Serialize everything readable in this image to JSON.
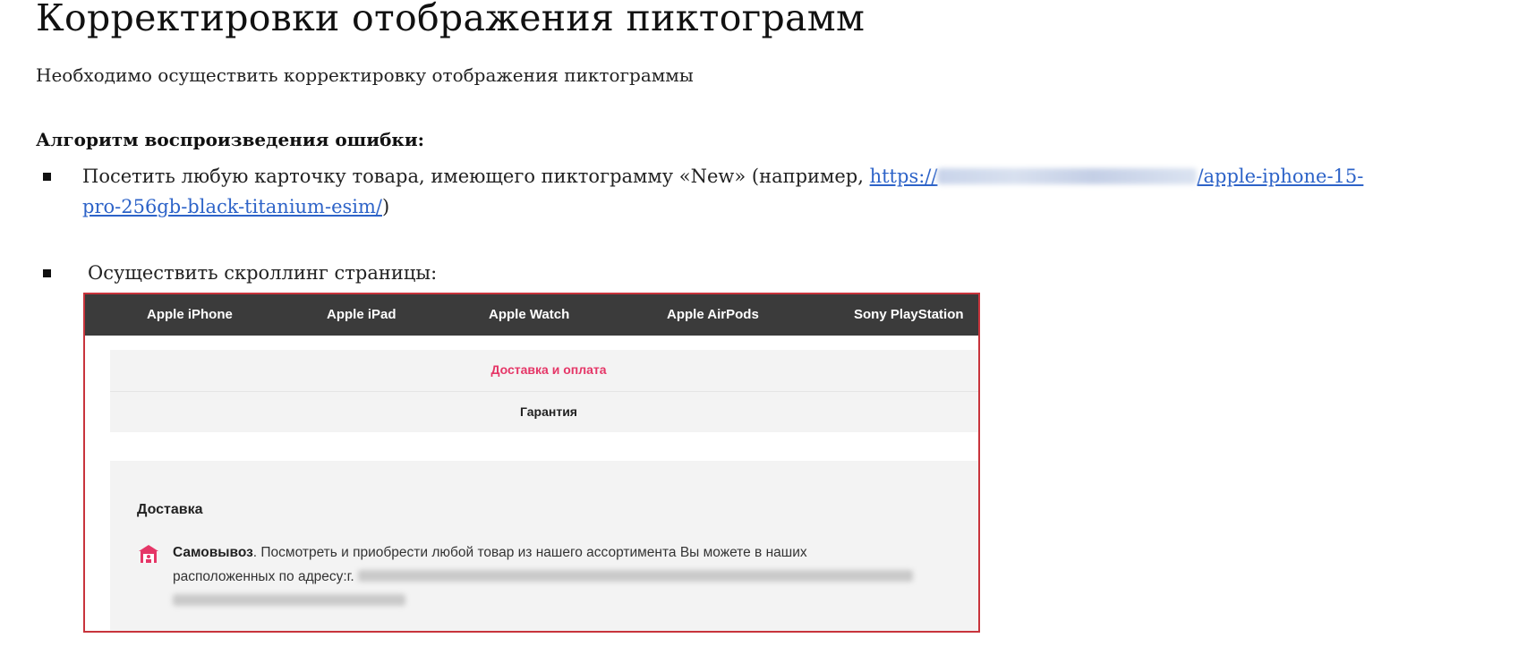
{
  "document": {
    "title": "Корректировки отображения пиктограмм",
    "intro": "Необходимо осуществить корректировку отображения пиктограммы",
    "algorithm_heading": "Алгоритм воспроизведения ошибки:",
    "step1": {
      "text_before": "Посетить любую карточку товара, имеющего пиктограмму «New» (например, ",
      "link_start": "https://",
      "link_end_line1": "/apple-iphone-15-",
      "link_line2": "pro-256gb-black-titanium-esim/",
      "text_after": ")"
    },
    "step2": {
      "text": "Осуществить скроллинг страницы:"
    }
  },
  "screenshot": {
    "nav": [
      "Apple iPhone",
      "Apple iPad",
      "Apple Watch",
      "Apple AirPods",
      "Sony PlayStation"
    ],
    "tabs": {
      "active": "Доставка и оплата",
      "second": "Гарантия"
    },
    "panel": {
      "heading": "Доставка",
      "pickup_bold": "Самовывоз",
      "pickup_text": ". Посмотреть и приобрести любой товар из нашего ассортимента Вы можете в наших",
      "pickup_line2": "расположенных по адресу:г."
    }
  },
  "colors": {
    "link": "#2d63c8",
    "nav_bg": "#3b3b3b",
    "active_tab": "#e53667",
    "frame_border": "#c8343c",
    "icon": "#e53667"
  }
}
